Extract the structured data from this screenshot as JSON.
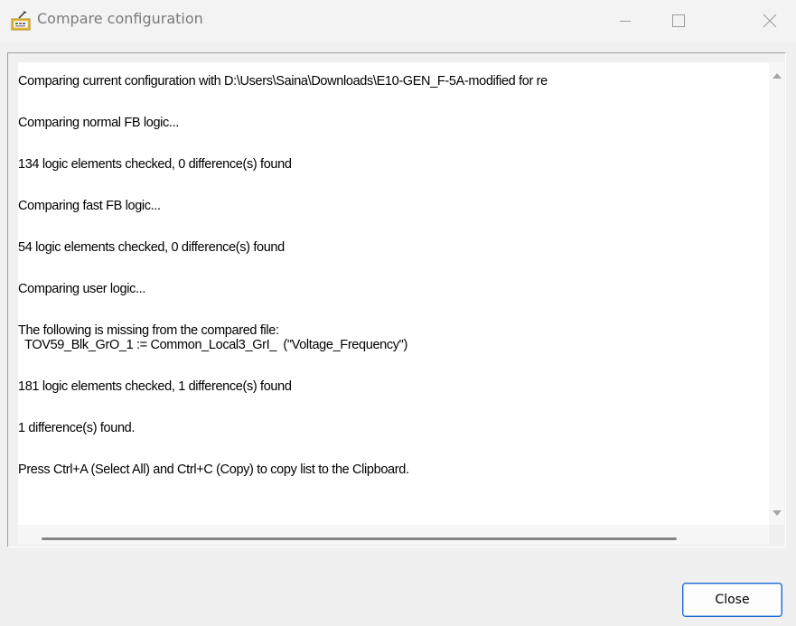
{
  "window": {
    "title": "Compare configuration",
    "icon": "compare-config-app-icon",
    "controls": {
      "minimize": "minimize-icon",
      "maximize": "maximize-icon",
      "close": "close-icon"
    }
  },
  "output": {
    "lines": [
      "Comparing current configuration with D:\\Users\\Saina\\Downloads\\E10-GEN_F-5A-modified for re",
      "Comparing normal FB logic...",
      "134 logic elements checked, 0 difference(s) found",
      "Comparing fast FB logic...",
      "54 logic elements checked, 0 difference(s) found",
      "Comparing user logic...",
      "The following is missing from the compared file:",
      "  TOV59_Blk_GrO_1 := Common_Local3_GrI_  (\"Voltage_Frequency\")",
      "181 logic elements checked, 1 difference(s) found",
      "1 difference(s) found.",
      "Press Ctrl+A (Select All) and Ctrl+C (Copy) to copy list to the Clipboard."
    ]
  },
  "buttons": {
    "close_label": "Close"
  },
  "colors": {
    "accent": "#1f6ad0",
    "title_text": "#7a7a7a"
  }
}
